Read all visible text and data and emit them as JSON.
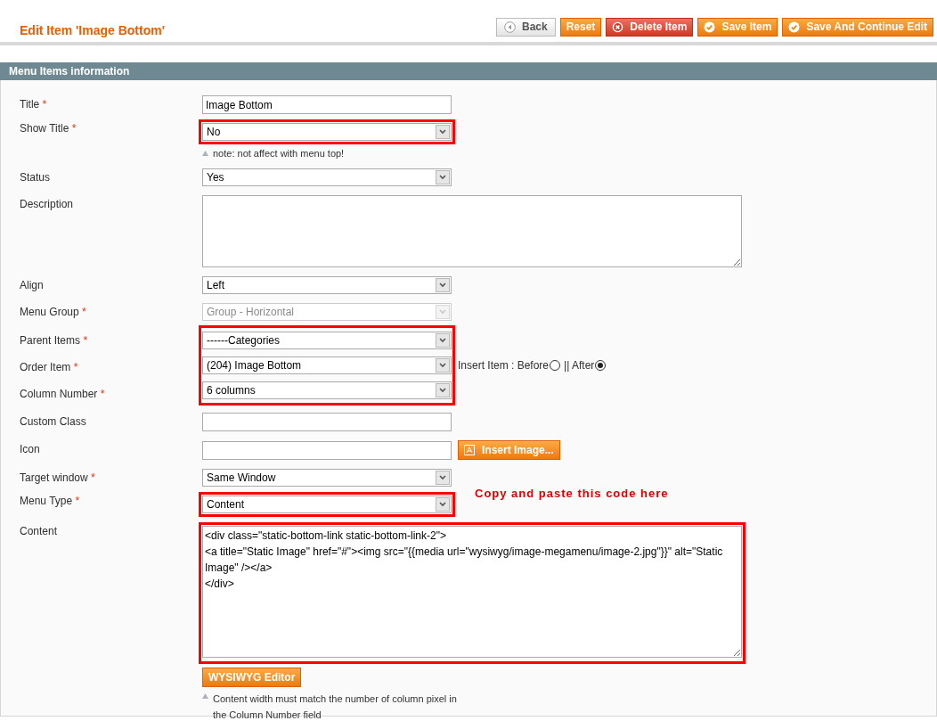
{
  "page": {
    "title": "Edit Item 'Image Bottom'"
  },
  "buttons": [
    {
      "label": "Back",
      "kind": "back"
    },
    {
      "label": "Reset",
      "kind": "plain"
    },
    {
      "label": "Delete Item",
      "kind": "delete"
    },
    {
      "label": "Save Item",
      "kind": "save"
    },
    {
      "label": "Save And Continue Edit",
      "kind": "save"
    }
  ],
  "section": {
    "title": "Menu Items information"
  },
  "fields": [
    {
      "kind": "text",
      "label": "Title",
      "marker": "*",
      "value": "Image Bottom",
      "highlighted": false
    },
    {
      "kind": "select",
      "label": "Show Title",
      "marker": "*",
      "value": "No",
      "disabled": false,
      "highlighted": true,
      "note": "note: not affect with menu top!"
    },
    {
      "kind": "select",
      "label": "Status",
      "value": "Yes",
      "disabled": false,
      "highlighted": false
    },
    {
      "kind": "textarea",
      "label": "Description",
      "highlighted": false
    },
    {
      "kind": "select",
      "label": "Align",
      "value": "Left",
      "disabled": false,
      "highlighted": false
    },
    {
      "kind": "select",
      "label": "Menu Group",
      "marker": "*",
      "value": "Group - Horizontal",
      "disabled": true,
      "highlighted": false
    },
    {
      "kind": "select",
      "label": "Parent Items",
      "marker": "*",
      "value": "------Categories",
      "disabled": false,
      "highlighted": true
    },
    {
      "kind": "select",
      "label": "Order Item",
      "marker": "*",
      "value": "(204) Image Bottom",
      "disabled": false,
      "highlighted": true,
      "options": [
        {
          "label": "Insert Item : Before",
          "selected": false
        },
        {
          "label": "|| After",
          "selected": true
        }
      ]
    },
    {
      "kind": "select",
      "label": "Column Number",
      "marker": "*",
      "value": "6 columns",
      "disabled": false,
      "highlighted": true
    },
    {
      "kind": "text",
      "label": "Custom Class",
      "highlighted": false
    },
    {
      "kind": "file",
      "label": "Icon",
      "button": "Insert Image...",
      "highlighted": false
    },
    {
      "kind": "select",
      "label": "Target window",
      "marker": "*",
      "value": "Same Window",
      "disabled": false,
      "highlighted": false
    },
    {
      "kind": "select",
      "label": "Menu Type",
      "marker": "*",
      "value": "Content",
      "disabled": false,
      "highlighted": true,
      "annotation": "Copy and paste this code here"
    },
    {
      "kind": "code",
      "label": "Content",
      "value": "<div class=\"static-bottom-link static-bottom-link-2\">\n<a title=\"Static Image\" href=\"#\"><img src=\"{{media url=\"wysiwyg/image-megamenu/image-2.jpg\"}}\" alt=\"Static Image\" /></a>\n</div>",
      "highlighted": true,
      "button": "WYSIWYG Editor",
      "note": "Content width must match the number of column pixel in the Column Number field"
    }
  ]
}
